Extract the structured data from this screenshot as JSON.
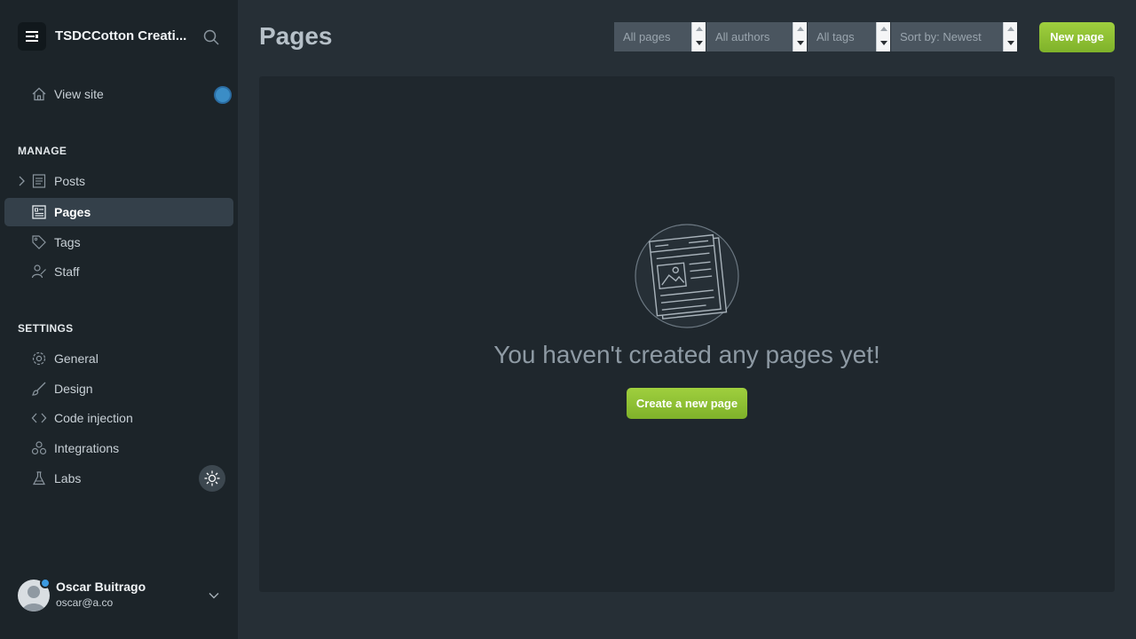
{
  "brand": {
    "title": "TSDCCotton Creati..."
  },
  "sidebar": {
    "view_site": "View site",
    "manage_heading": "MANAGE",
    "manage_items": [
      {
        "label": "Posts",
        "icon": "posts-icon"
      },
      {
        "label": "Pages",
        "icon": "pages-icon",
        "active": true
      },
      {
        "label": "Tags",
        "icon": "tag-icon"
      },
      {
        "label": "Staff",
        "icon": "staff-icon"
      }
    ],
    "settings_heading": "SETTINGS",
    "settings_items": [
      {
        "label": "General",
        "icon": "gear-icon"
      },
      {
        "label": "Design",
        "icon": "brush-icon"
      },
      {
        "label": "Code injection",
        "icon": "code-icon"
      },
      {
        "label": "Integrations",
        "icon": "integrations-icon"
      },
      {
        "label": "Labs",
        "icon": "flask-icon"
      }
    ]
  },
  "user": {
    "name": "Oscar Buitrago",
    "email": "oscar@a.co"
  },
  "header": {
    "title": "Pages",
    "filters": {
      "type": "All pages",
      "author": "All authors",
      "tag": "All tags",
      "sort": "Sort by: Newest"
    },
    "new_button": "New page"
  },
  "empty_state": {
    "message": "You haven't created any pages yet!",
    "button": "Create a new page"
  },
  "colors": {
    "accent_green": "#8fc035",
    "sidebar_bg": "#1c2429",
    "main_bg": "#262f36",
    "notification_blue": "#3b8dc6"
  }
}
